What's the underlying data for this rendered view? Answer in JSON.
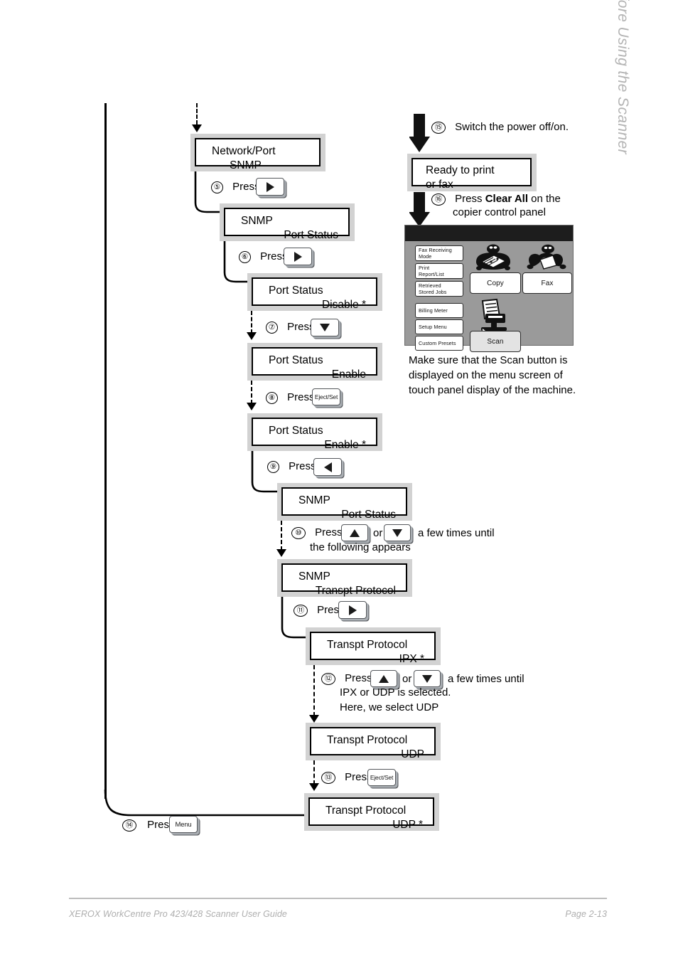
{
  "page": {
    "running_head": "Before Using the Scanner",
    "footer_left": "XEROX WorkCentre Pro 423/428 Scanner User Guide",
    "footer_right": "Page 2-13"
  },
  "words": {
    "press": "Press",
    "or": "or"
  },
  "lcd_screens": [
    {
      "id": "network-port-snmp",
      "line1": "Network/Port",
      "line2": "SNMP",
      "line2_align": "center"
    },
    {
      "id": "snmp-port-status",
      "line1": "SNMP",
      "line2": "Port Status"
    },
    {
      "id": "port-status-disable",
      "line1": "Port Status",
      "line2": "Disable *"
    },
    {
      "id": "port-status-enable",
      "line1": "Port Status",
      "line2": "Enable"
    },
    {
      "id": "port-status-enable-set",
      "line1": "Port Status",
      "line2": "Enable *"
    },
    {
      "id": "snmp-port-status-2",
      "line1": "SNMP",
      "line2": "Port Status"
    },
    {
      "id": "snmp-transpt-protocol",
      "line1": "SNMP",
      "line2": "Transpt Protocol"
    },
    {
      "id": "transpt-protocol-ipx",
      "line1": "Transpt Protocol",
      "line2": "IPX *"
    },
    {
      "id": "transpt-protocol-udp",
      "line1": "Transpt Protocol",
      "line2": "UDP"
    },
    {
      "id": "transpt-protocol-udp-set",
      "line1": "Transpt Protocol",
      "line2": "UDP *"
    },
    {
      "id": "ready-to-print",
      "line1": "Ready to print",
      "line2": "or fax",
      "line2_align": "left"
    }
  ],
  "steps": {
    "s5": {
      "num": "⑤",
      "label": "Press",
      "key": "right-arrow"
    },
    "s6": {
      "num": "⑥",
      "label": "Press",
      "key": "right-arrow"
    },
    "s7": {
      "num": "⑦",
      "label": "Press",
      "key": "down-arrow"
    },
    "s8": {
      "num": "⑧",
      "label": "Press",
      "key": "Eject/Set"
    },
    "s9": {
      "num": "⑨",
      "label": "Press",
      "key": "left-arrow"
    },
    "s10": {
      "num": "⑩",
      "label": "Press",
      "key_a": "up-arrow",
      "or": "or",
      "key_b": "down-arrow",
      "tail1": "a few times until",
      "tail2": "the following appears"
    },
    "s11": {
      "num": "⑪",
      "label": "Press",
      "key": "right-arrow"
    },
    "s12": {
      "num": "⑫",
      "label": "Press",
      "key_a": "up-arrow",
      "or": "or",
      "key_b": "down-arrow",
      "tail1": "a few times until",
      "tail2": "IPX or UDP is selected.",
      "tail3": "Here, we select UDP"
    },
    "s13": {
      "num": "⑬",
      "label": "Press",
      "key": "Eject/Set"
    },
    "s14": {
      "num": "⑭",
      "label": "Press",
      "key": "Menu"
    },
    "s15": {
      "num": "⑮",
      "text": "Switch the power off/on."
    },
    "s16": {
      "num": "⑯",
      "text_a": "Press ",
      "text_b": "Clear All",
      "text_c": " on the",
      "text_d": "copier control panel"
    }
  },
  "touch_panel": {
    "left_buttons": [
      "Fax Receiving\nMode",
      "Print\nReport/List",
      "Retrieved\nStored Jobs",
      "Billing Meter",
      "Setup Menu",
      "Custom Presets"
    ],
    "main_buttons": [
      "Copy",
      "Fax",
      "Scan"
    ],
    "caption": "Make sure that the Scan button is displayed on the menu screen of touch panel display of the machine."
  },
  "colors": {
    "lcd_frame": "#d2d2d2",
    "panel_bg": "#9a9a9a",
    "panel_titlebar": "#1d1d1d",
    "footer_gray": "#aeaeae"
  }
}
